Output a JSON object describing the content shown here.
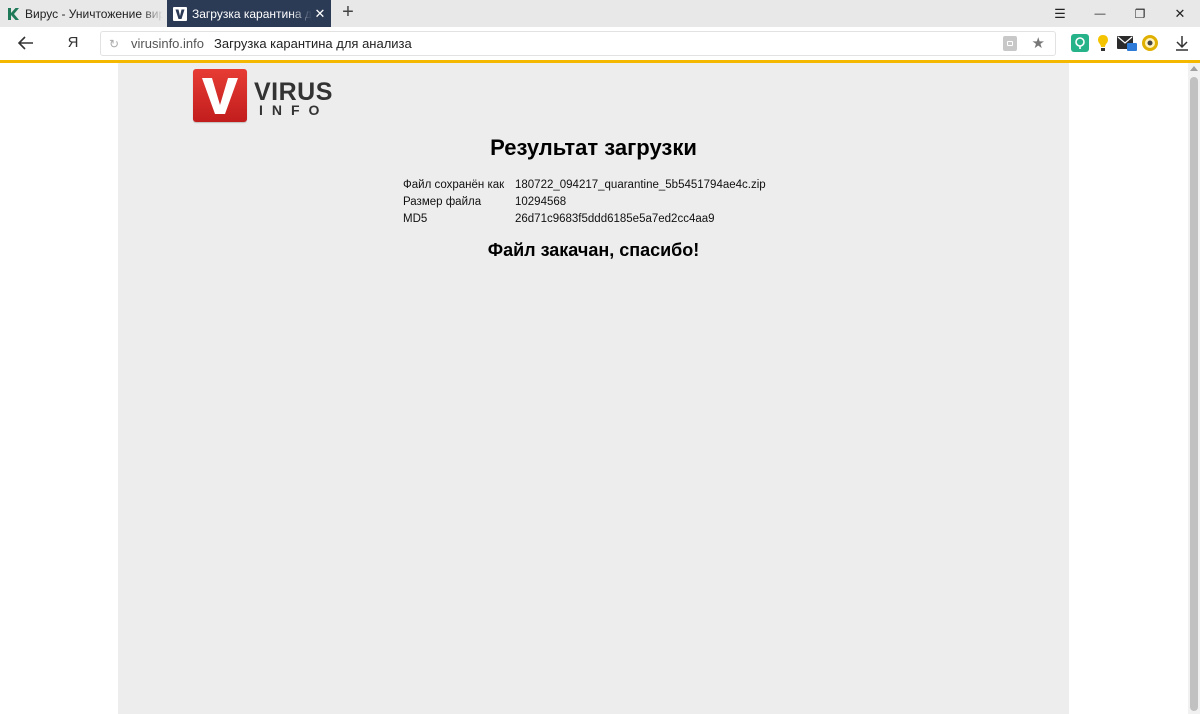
{
  "browser": {
    "tabs": [
      {
        "title": "Вирус - Уничтожение вирусов",
        "favicon": "kaspersky-k-icon",
        "active": false
      },
      {
        "title": "Загрузка карантина для анализа",
        "favicon": "virusinfo-v-icon",
        "active": true
      }
    ],
    "new_tab_label": "+",
    "window_controls": {
      "menu": "☰",
      "minimize": "—",
      "restore": "❐",
      "close": "✕"
    },
    "address_bar": {
      "domain": "virusinfo.info",
      "page_title": "Загрузка карантина для анализа"
    },
    "yandex_label": "Я",
    "accent_color": "#f5b800"
  },
  "page": {
    "logo": {
      "word1": "VIRUS",
      "word2": "INFO",
      "letter": "V"
    },
    "heading": "Результат загрузки",
    "info_rows": [
      {
        "label": "Файл сохранён как",
        "value": "180722_094217_quarantine_5b5451794ae4c.zip"
      },
      {
        "label": "Размер файла",
        "value": "10294568"
      },
      {
        "label": "MD5",
        "value": "26d71c9683f5ddd6185e5a7ed2cc4aa9"
      }
    ],
    "thanks": "Файл закачан, спасибо!"
  }
}
